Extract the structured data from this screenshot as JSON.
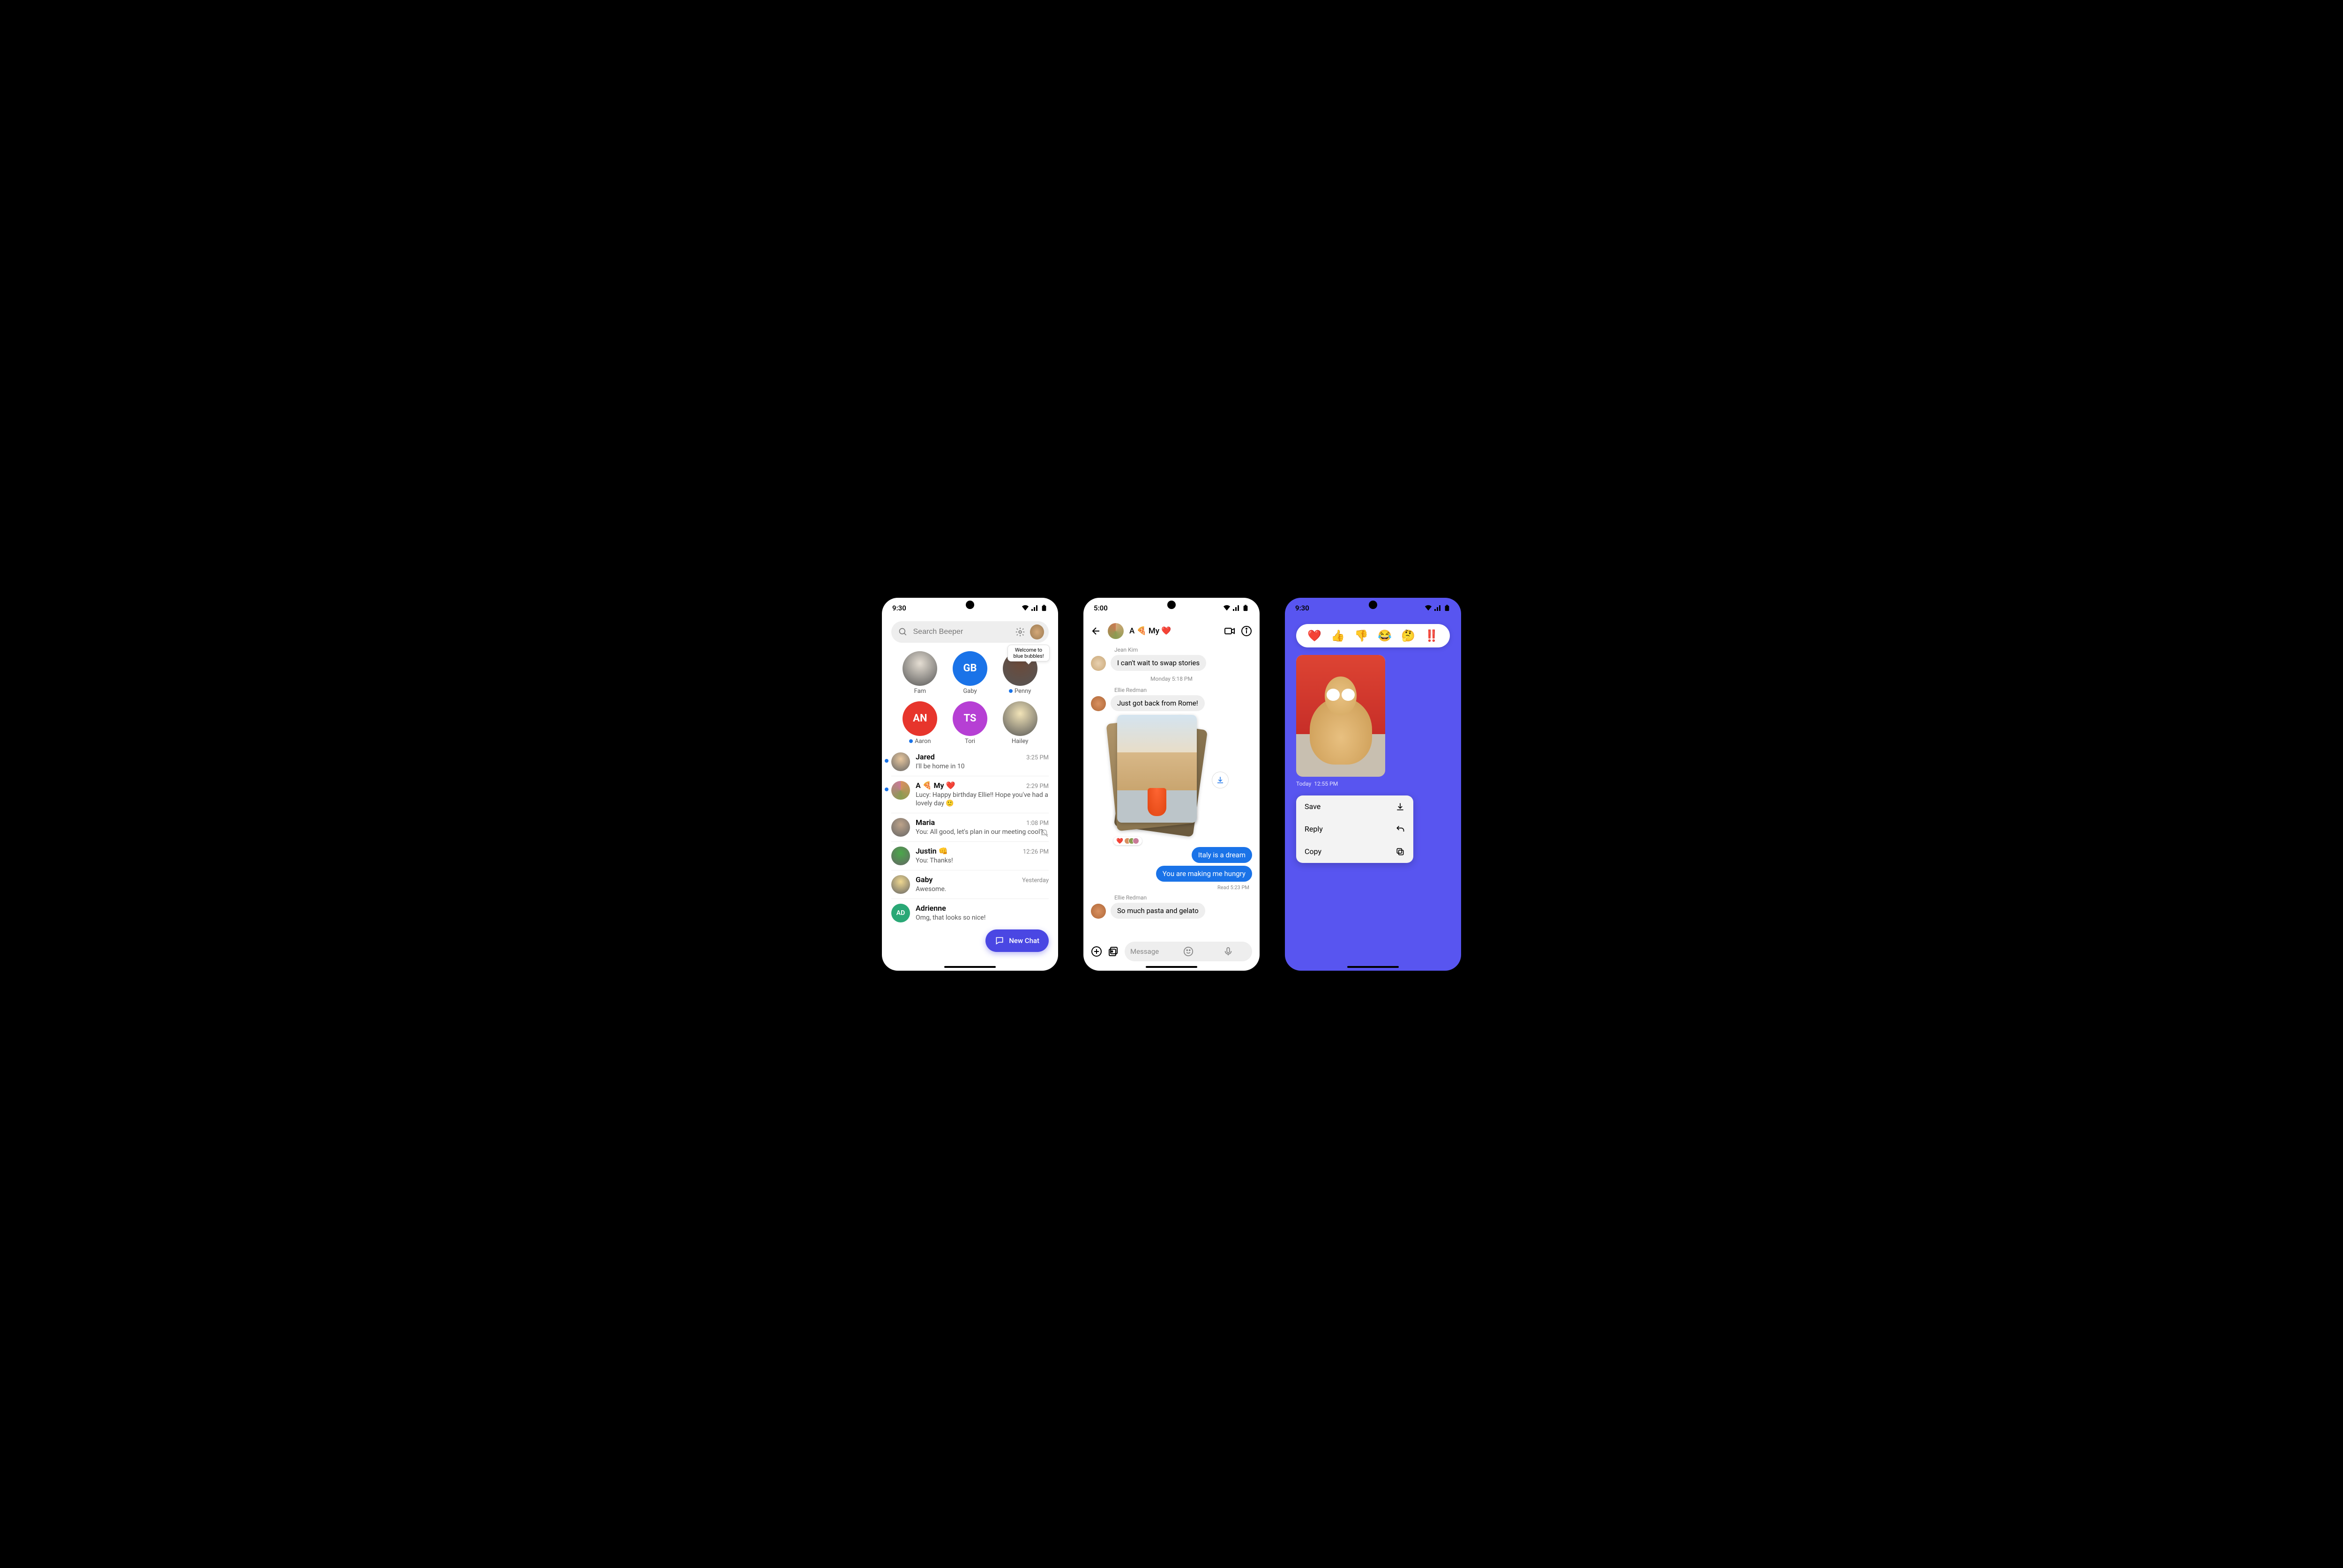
{
  "phone1": {
    "time": "9:30",
    "search_placeholder": "Search Beeper",
    "tooltip": "Welcome to blue bubbles!",
    "favorites": [
      {
        "label": "Fam",
        "bg": "#e5ded3",
        "abbr": "",
        "photo": true,
        "dot": false
      },
      {
        "label": "Gaby",
        "bg": "#1a73e8",
        "abbr": "GB",
        "photo": false,
        "dot": false
      },
      {
        "label": "Penny",
        "bg": "#6b4a3a",
        "abbr": "",
        "photo": true,
        "dot": true
      },
      {
        "label": "Aaron",
        "bg": "#e7352c",
        "abbr": "AN",
        "photo": false,
        "dot": true
      },
      {
        "label": "Tori",
        "bg": "#b63fd4",
        "abbr": "TS",
        "photo": false,
        "dot": false
      },
      {
        "label": "Hailey",
        "bg": "#f2e4b8",
        "abbr": "",
        "photo": true,
        "dot": false
      }
    ],
    "chats": [
      {
        "name": "Jared",
        "time": "3:25 PM",
        "preview": "I'll be home in 10",
        "unread": true,
        "av": "#e8c79e"
      },
      {
        "name": "A 🍕 My ❤️",
        "time": "2:29 PM",
        "preview": "Lucy: Happy birthday Ellie!! Hope you've had a lovely day   🙂",
        "unread": true,
        "group": true
      },
      {
        "name": "Maria",
        "time": "1:08 PM",
        "preview": "You: All good, let's plan in our meeting cool?",
        "muted": true,
        "av": "#bda38a"
      },
      {
        "name": "Justin 👊",
        "time": "12:26 PM",
        "preview": "You: Thanks!",
        "av": "#4aa84a"
      },
      {
        "name": "Gaby",
        "time": "Yesterday",
        "preview": "Awesome.",
        "av": "#f0d890"
      },
      {
        "name": "Adrienne",
        "time": "",
        "preview": "Omg, that looks so nice!",
        "av": "#2aa876",
        "abbr": "AD"
      }
    ],
    "fab_label": "New Chat"
  },
  "phone2": {
    "time": "5:00",
    "title": "A 🍕 My ❤️",
    "msgs": {
      "s1": "Jean Kim",
      "m1": "I can't wait to swap stories",
      "t1": "Monday 5:18 PM",
      "s2": "Ellie Redman",
      "m2": "Just got back from Rome!",
      "reaction": "❤️",
      "m3": "Italy is a dream",
      "m4": "You are making me hungry",
      "read": "Read  5:23 PM",
      "s3": "Ellie Redman",
      "m5": "So much pasta and gelato"
    },
    "compose_placeholder": "Message"
  },
  "phone3": {
    "time": "9:30",
    "reactions": [
      "❤️",
      "👍",
      "👎",
      "😂",
      "🤔",
      "‼️"
    ],
    "ts_day": "Today",
    "ts_time": "12:55 PM",
    "menu": [
      {
        "label": "Save",
        "icon": "download"
      },
      {
        "label": "Reply",
        "icon": "reply"
      },
      {
        "label": "Copy",
        "icon": "copy"
      }
    ]
  }
}
